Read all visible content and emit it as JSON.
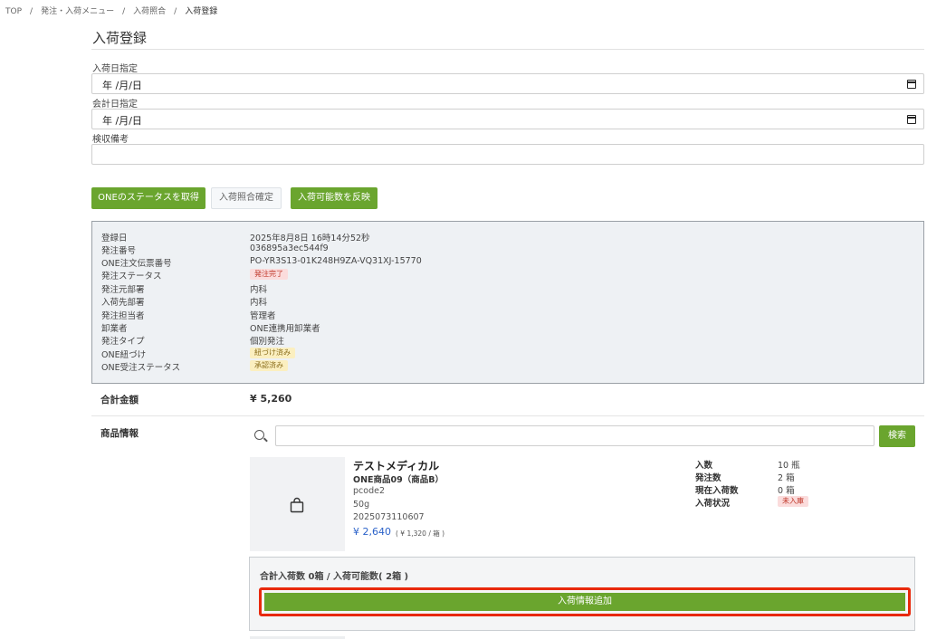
{
  "breadcrumb": {
    "items": [
      "TOP",
      "発注・入荷メニュー",
      "入荷照合",
      "入荷登録"
    ],
    "separator": "/"
  },
  "page": {
    "title": "入荷登録"
  },
  "form": {
    "arrival_date": {
      "label": "入荷日指定",
      "value": "年 /月/日"
    },
    "accounting_date": {
      "label": "会計日指定",
      "value": "年 /月/日"
    },
    "inspection_note": {
      "label": "検収備考",
      "value": ""
    }
  },
  "actions": {
    "fetch_status": "ONEのステータスを取得",
    "confirm_match": "入荷照合確定",
    "reflect_qty": "入荷可能数を反映"
  },
  "order_info": [
    {
      "key": "登録日",
      "value": "2025年8月8日 16時14分52秒"
    },
    {
      "key": "発注番号",
      "value": "036895a3ec544f9"
    },
    {
      "key": "ONE注文伝票番号",
      "value": "PO-YR3S13-01K248H9ZA-VQ31XJ-15770"
    },
    {
      "key": "発注ステータス",
      "value": "発注完了",
      "badge": "red"
    },
    {
      "key": "発注元部署",
      "value": "内科"
    },
    {
      "key": "入荷先部署",
      "value": "内科"
    },
    {
      "key": "発注担当者",
      "value": "管理者"
    },
    {
      "key": "卸業者",
      "value": "ONE連携用卸業者"
    },
    {
      "key": "発注タイプ",
      "value": "個別発注"
    },
    {
      "key": "ONE紐づけ",
      "value": "紐づけ済み",
      "badge": "yellow"
    },
    {
      "key": "ONE受注ステータス",
      "value": "承認済み",
      "badge": "yellow"
    }
  ],
  "total": {
    "label": "合計金額",
    "value": "¥ 5,260"
  },
  "products": {
    "label": "商品情報",
    "search_button": "検索",
    "item": {
      "maker": "テストメディカル",
      "name": "ONE商品09（商品B）",
      "code": "pcode2",
      "spec": "50g",
      "jan": "2025073110607",
      "price": "¥ 2,640",
      "unit_price": "( ¥ 1,320 / 箱 )",
      "stats": [
        {
          "key": "入数",
          "value": "10 瓶"
        },
        {
          "key": "発注数",
          "value": "2 箱"
        },
        {
          "key": "現在入荷数",
          "value": "0 箱"
        },
        {
          "key": "入荷状況",
          "value": "未入庫",
          "badge": "red"
        }
      ]
    },
    "arrival_summary": "合計入荷数 0箱 / 入荷可能数( 2箱 )",
    "add_button": "入荷情報追加"
  },
  "colors": {
    "accent_green": "#6aa52e",
    "highlight_red": "#e8290b",
    "price_blue": "#2b62c9"
  }
}
